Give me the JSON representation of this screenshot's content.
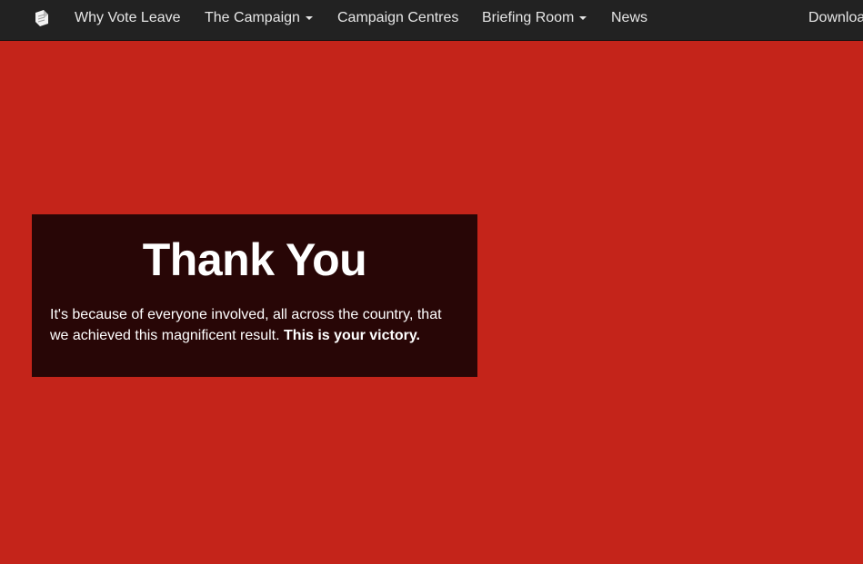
{
  "nav": {
    "brand_icon": "vote-leave-logo-icon",
    "items": [
      {
        "label": "Why Vote Leave",
        "dropdown": false
      },
      {
        "label": "The Campaign",
        "dropdown": true
      },
      {
        "label": "Campaign Centres",
        "dropdown": false
      },
      {
        "label": "Briefing Room",
        "dropdown": true
      },
      {
        "label": "News",
        "dropdown": false
      },
      {
        "label": "Downloa",
        "dropdown": false
      }
    ]
  },
  "panel": {
    "title": "Thank You",
    "body": "It's because of everyone involved, all across the country, that we achieved this magnificent result. ",
    "emphasis": "This is your victory."
  },
  "colors": {
    "background": "#c4241a",
    "navbar": "#222222",
    "panel": "#280606"
  }
}
